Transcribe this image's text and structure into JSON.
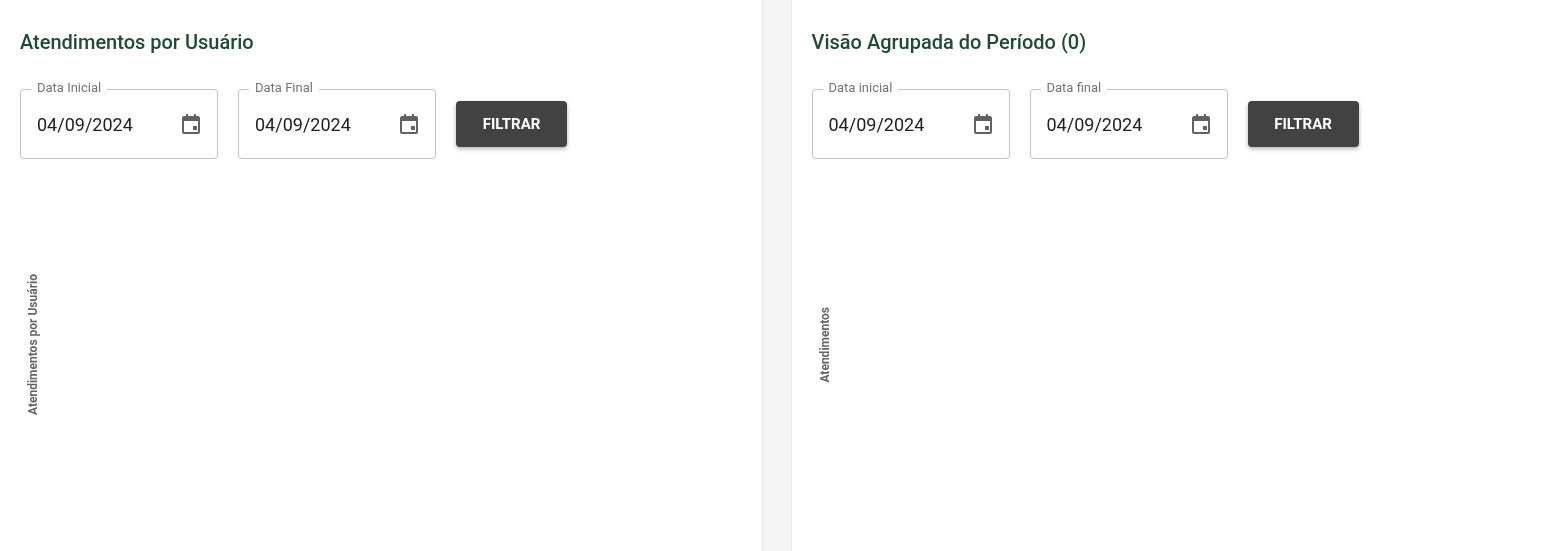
{
  "panels": [
    {
      "title": "Atendimentos por Usuário",
      "fields": [
        {
          "label": "Data Inicial",
          "value": "04/09/2024"
        },
        {
          "label": "Data Final",
          "value": "04/09/2024"
        }
      ],
      "button": "FILTRAR",
      "axis_label": "Atendimentos por Usuário"
    },
    {
      "title": "Visão Agrupada do Período (0)",
      "fields": [
        {
          "label": "Data inicial",
          "value": "04/09/2024"
        },
        {
          "label": "Data final",
          "value": "04/09/2024"
        }
      ],
      "button": "FILTRAR",
      "axis_label": "Atendimentos"
    }
  ]
}
